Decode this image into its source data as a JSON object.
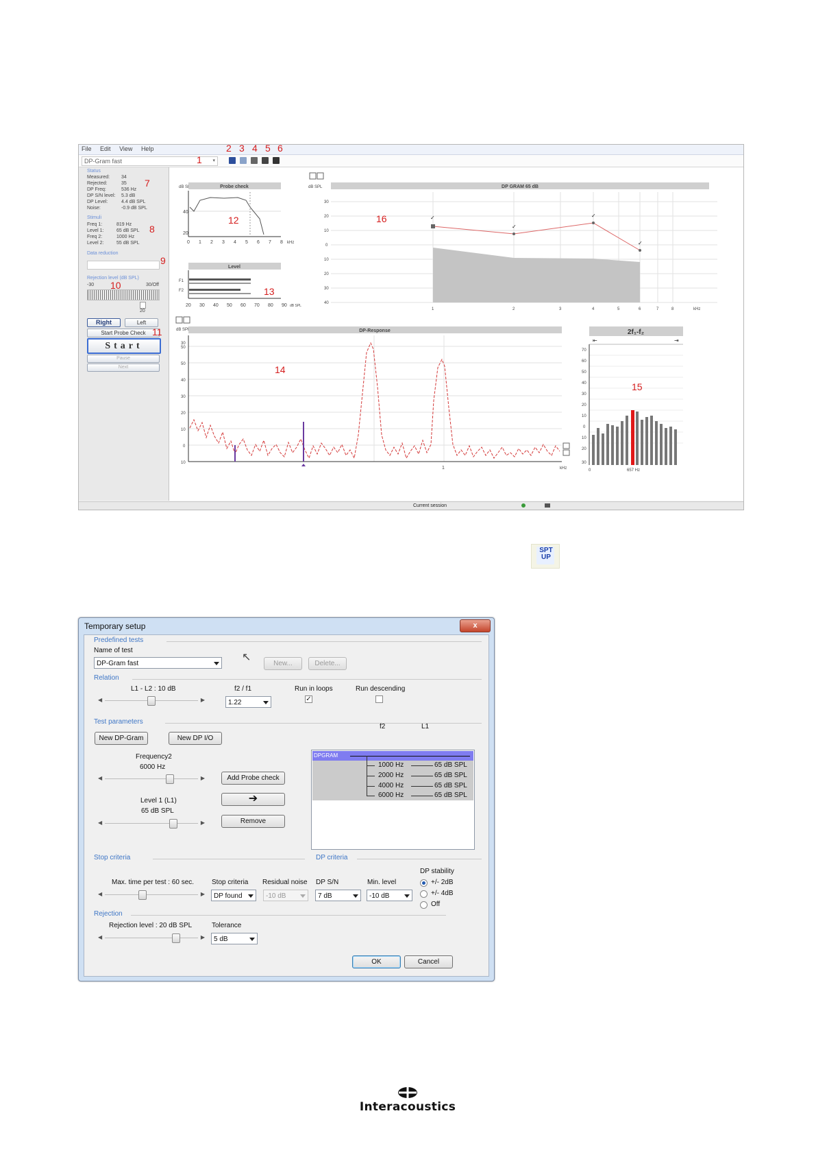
{
  "app": {
    "menu": [
      "File",
      "Edit",
      "View",
      "Help"
    ],
    "test_selector": "DP-Gram fast",
    "callouts": [
      "1",
      "2",
      "3",
      "4",
      "5",
      "6",
      "7",
      "8",
      "9",
      "10",
      "11",
      "12",
      "13",
      "14",
      "15",
      "16"
    ],
    "status": {
      "header": "Status",
      "rows": [
        {
          "label": "Measured:",
          "value": "34"
        },
        {
          "label": "Rejected:",
          "value": "35"
        },
        {
          "label": "DP Freq:",
          "value": "536 Hz"
        },
        {
          "label": "DP S/N level:",
          "value": "5.3 dB"
        },
        {
          "label": "DP Level:",
          "value": "4.4 dB SPL"
        },
        {
          "label": "Noise:",
          "value": "-0.9 dB SPL"
        }
      ]
    },
    "stimuli": {
      "header": "Stimuli",
      "rows": [
        {
          "label": "Freq 1:",
          "value": "819 Hz"
        },
        {
          "label": "Level 1:",
          "value": "65 dB SPL"
        },
        {
          "label": "Freq 2:",
          "value": "1000 Hz"
        },
        {
          "label": "Level 2:",
          "value": "55 dB SPL"
        }
      ]
    },
    "data_reduction_label": "Data reduction",
    "rejection": {
      "label": "Rejection level (dB SPL)",
      "min": "-30",
      "max": "30/Off",
      "current": "20"
    },
    "buttons": {
      "right": "Right",
      "left": "Left",
      "probe_check": "Start Probe Check",
      "start": "Start",
      "pause": "Pause",
      "next": "Next"
    },
    "statusbar_text": "Current session",
    "probe_check": {
      "title": "Probe check",
      "unit": "dB SPL",
      "x_unit": "kHz",
      "xticks": [
        "0",
        "1",
        "2",
        "3",
        "4",
        "5",
        "6",
        "7",
        "8"
      ],
      "yticks": [
        "40",
        "20"
      ]
    },
    "level": {
      "title": "Level",
      "rows": [
        "F1",
        "F2"
      ],
      "xticks": [
        "20",
        "30",
        "40",
        "50",
        "60",
        "70",
        "80",
        "90"
      ],
      "x_unit": "dB SPL"
    },
    "dp_response": {
      "title": "DP-Response",
      "unit": "dB SPL",
      "yticks": [
        "30",
        "50",
        "50",
        "40",
        "30",
        "20",
        "10",
        "0",
        "10"
      ],
      "x_unit": "kHz",
      "xtick": "1"
    },
    "two_f1_f2": {
      "title": "2f₁-f₂",
      "yticks": [
        "70",
        "60",
        "50",
        "40",
        "30",
        "20",
        "10",
        "0",
        "10",
        "20",
        "30"
      ],
      "x0": "0",
      "xlabel": "657 Hz"
    },
    "dp_gram": {
      "title": "DP GRAM 65 dB",
      "unit": "dB SPL",
      "yticks": [
        "30",
        "20",
        "10",
        "0",
        "10",
        "20",
        "30",
        "40"
      ],
      "xticks": [
        "1",
        "2",
        "3",
        "4",
        "5",
        "6",
        "7",
        "8"
      ],
      "x_unit": "kHz"
    }
  },
  "icon_label": "SPT UP",
  "dialog": {
    "title": "Temporary setup",
    "close": "x",
    "predefined_tests": {
      "header": "Predefined tests",
      "name_label": "Name of test",
      "name_value": "DP-Gram fast",
      "new": "New...",
      "delete": "Delete..."
    },
    "relation": {
      "header": "Relation",
      "l1l2_label": "L1 - L2 : 10 dB",
      "ratio_label": "f2 / f1",
      "ratio_value": "1.22",
      "run_in_loops": "Run in loops",
      "run_in_loops_checked": true,
      "run_descending": "Run descending",
      "run_descending_checked": false
    },
    "test_parameters": {
      "header": "Test parameters",
      "new_dpgram": "New DP-Gram",
      "new_dpio": "New DP I/O",
      "frequency2_label": "Frequency2",
      "frequency2_value": "6000 Hz",
      "level1_label": "Level 1 (L1)",
      "level1_value": "65 dB SPL",
      "add_probe_check": "Add Probe check",
      "arrow": "➔",
      "remove": "Remove",
      "list_header_f2": "f2",
      "list_header_l1": "L1",
      "list_group": "DPGRAM",
      "list_rows": [
        {
          "f2": "1000 Hz",
          "l1": "65 dB SPL"
        },
        {
          "f2": "2000 Hz",
          "l1": "65 dB SPL"
        },
        {
          "f2": "4000 Hz",
          "l1": "65 dB SPL"
        },
        {
          "f2": "6000 Hz",
          "l1": "65 dB SPL"
        }
      ]
    },
    "stop_criteria": {
      "header": "Stop criteria",
      "max_time_label": "Max. time per test : 60 sec.",
      "stop_label": "Stop criteria",
      "stop_value": "DP found",
      "residual_label": "Residual noise",
      "residual_value": "-10 dB"
    },
    "dp_criteria": {
      "header": "DP criteria",
      "sn_label": "DP S/N",
      "sn_value": "7 dB",
      "min_level_label": "Min. level",
      "min_level_value": "-10 dB",
      "stability_label": "DP stability",
      "stability_options": [
        "+/- 2dB",
        "+/- 4dB",
        "Off"
      ]
    },
    "rejection": {
      "header": "Rejection",
      "level_label": "Rejection level : 20 dB SPL",
      "tolerance_label": "Tolerance",
      "tolerance_value": "5 dB"
    },
    "ok": "OK",
    "cancel": "Cancel"
  },
  "footer": {
    "brand": "Interacoustics"
  }
}
